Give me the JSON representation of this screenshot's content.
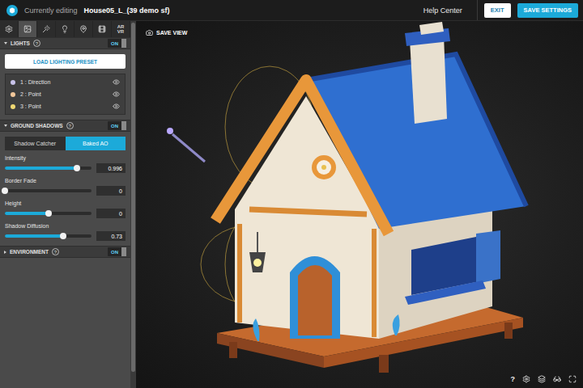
{
  "topbar": {
    "prefix": "Currently editing",
    "title": "House05_L_(39 demo sf)",
    "link": "Help Center",
    "buttons": [
      {
        "label": "EXIT",
        "primary": false
      },
      {
        "label": "SAVE SETTINGS",
        "primary": true
      }
    ]
  },
  "tool_tabs": [
    {
      "kind": "icon",
      "selected": false
    },
    {
      "kind": "icon",
      "selected": true
    },
    {
      "kind": "icon",
      "selected": false
    },
    {
      "kind": "icon",
      "selected": false
    },
    {
      "kind": "icon",
      "selected": false
    },
    {
      "kind": "icon",
      "selected": false
    },
    {
      "kind": "text",
      "label": "AR VR",
      "selected": false
    }
  ],
  "lights_section": {
    "title": "LIGHTS",
    "help": "?",
    "expanded": true,
    "toggle": {
      "label": "ON",
      "on": true
    },
    "preset_button": "LOAD LIGHTING PRESET",
    "lights": [
      {
        "name": "1 : Direction",
        "color": "#c9c3ea",
        "visible": true
      },
      {
        "name": "2 : Point",
        "color": "#f2c79a",
        "visible": true
      },
      {
        "name": "3 : Point",
        "color": "#f0d873",
        "visible": true
      }
    ]
  },
  "ground_shadows": {
    "title": "GROUND SHADOWS",
    "help": "?",
    "expanded": true,
    "toggle": {
      "label": "ON",
      "on": true
    },
    "modes": [
      {
        "label": "Shadow Catcher",
        "selected": false
      },
      {
        "label": "Baked AO",
        "selected": true
      }
    ],
    "sliders": [
      {
        "label": "Intensity",
        "level": 0.83,
        "value": "0.996"
      },
      {
        "label": "Border Fade",
        "level": 0,
        "value": "0"
      },
      {
        "label": "Height",
        "level": 0.5,
        "value": "0"
      },
      {
        "label": "Shadow Diffusion",
        "level": 0.67,
        "value": "0.73"
      }
    ]
  },
  "environment": {
    "title": "ENVIRONMENT",
    "help": "?",
    "expanded": false,
    "toggle": {
      "label": "ON",
      "on": true
    }
  },
  "viewport": {
    "save_view": "SAVE VIEW",
    "help": "?"
  }
}
